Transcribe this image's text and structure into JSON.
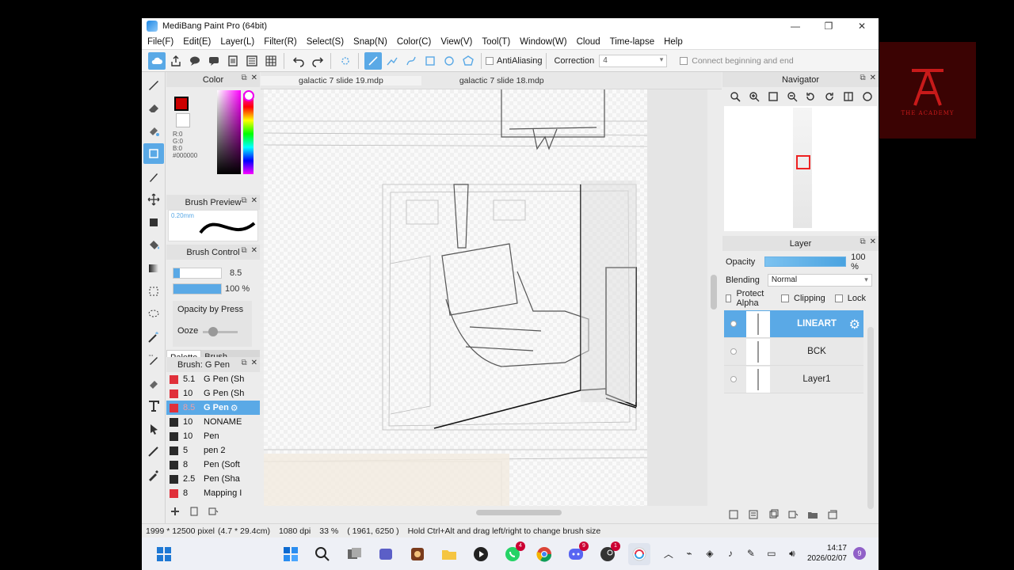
{
  "window": {
    "title": "MediBang Paint Pro (64bit)",
    "min": "—",
    "max": "❐",
    "close": "✕"
  },
  "menu": [
    "File(F)",
    "Edit(E)",
    "Layer(L)",
    "Filter(R)",
    "Select(S)",
    "Snap(N)",
    "Color(C)",
    "View(V)",
    "Tool(T)",
    "Window(W)",
    "Cloud",
    "Time-lapse",
    "Help"
  ],
  "toolbar": {
    "antialiasing": "AntiAliasing",
    "correction_label": "Correction",
    "correction_value": "4",
    "connect": "Connect beginning and end"
  },
  "panels": {
    "color": "Color",
    "rgb": [
      "R:0",
      "G:0",
      "B:0",
      "#000000"
    ],
    "brush_preview": "Brush Preview",
    "brush_preview_size": "0.20mm",
    "brush_control": "Brush Control",
    "size_value": "8.5",
    "opacity_value": "100 %",
    "opacity_by_pressure": "Opacity by Press",
    "ooze": "Ooze",
    "tab_palette": "Palette",
    "tab_brush_control": "Brush Control",
    "brush_header": "Brush: G Pen"
  },
  "brushes": [
    {
      "size": "5.1",
      "name": "G Pen (Sh",
      "color": "#e0303a",
      "selected": false
    },
    {
      "size": "10",
      "name": "G Pen (Sh",
      "color": "#e0303a",
      "selected": false
    },
    {
      "size": "8.5",
      "name": "G Pen",
      "color": "#e0303a",
      "selected": true
    },
    {
      "size": "10",
      "name": "NONAME",
      "color": "#2a2a2a",
      "selected": false
    },
    {
      "size": "10",
      "name": "Pen",
      "color": "#2a2a2a",
      "selected": false
    },
    {
      "size": "5",
      "name": "pen 2",
      "color": "#2a2a2a",
      "selected": false
    },
    {
      "size": "8",
      "name": "Pen (Soft",
      "color": "#2a2a2a",
      "selected": false
    },
    {
      "size": "2.5",
      "name": "Pen (Sha",
      "color": "#2a2a2a",
      "selected": false
    },
    {
      "size": "8",
      "name": "Mapping I",
      "color": "#e0303a",
      "selected": false
    }
  ],
  "doc_tabs": [
    "galactic 7 slide 19.mdp",
    "galactic 7 slide 18.mdp"
  ],
  "navigator": {
    "title": "Navigator"
  },
  "layer_panel": {
    "title": "Layer",
    "opacity_label": "Opacity",
    "opacity_value": "100 %",
    "blending_label": "Blending",
    "blending_value": "Normal",
    "protect_alpha": "Protect Alpha",
    "clipping": "Clipping",
    "lock": "Lock"
  },
  "layers": [
    {
      "name": "LINEART",
      "selected": true
    },
    {
      "name": "BCK",
      "selected": false
    },
    {
      "name": "Layer1",
      "selected": false
    }
  ],
  "status": {
    "size": "1999 * 12500 pixel",
    "physical": "(4.7 * 29.4cm)",
    "dpi": "1080 dpi",
    "zoom": "33 %",
    "coords": "( 1961, 6250 )",
    "hint": "Hold Ctrl+Alt and drag left/right to change brush size"
  },
  "taskbar": {
    "time": "14:17",
    "date": "2026/02/07",
    "notifications": "9"
  },
  "logo": {
    "text": "THE ACADEMY"
  },
  "colors": {
    "accent": "#5aa9e6",
    "fg_color": "#cc0000"
  }
}
